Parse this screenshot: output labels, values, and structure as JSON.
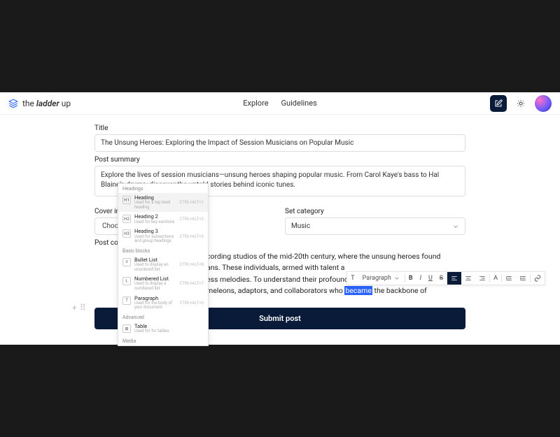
{
  "brand": {
    "pre": "the",
    "em": "ladder",
    "post": "up"
  },
  "nav": {
    "explore": "Explore",
    "guidelines": "Guidelines"
  },
  "labels": {
    "title": "Title",
    "summary": "Post summary",
    "cover": "Cover im",
    "category": "Set category",
    "content": "Post con"
  },
  "fields": {
    "title": "The Unsung Heroes: Exploring the Impact of Session Musicians on Popular Music",
    "summary": "Explore the lives of session musicians—unsung heroes shaping popular music. From Carol Kaye's bass to Hal Blaine's drums, discover the untold stories behind iconic tunes.",
    "choose": "Choo",
    "category": "Music"
  },
  "doc": {
    "l1a": "cording studios of the mid-20th century, where the unsung heroes found",
    "l2a": "ans. These individuals, armed with talent a",
    "l3a": "ess melodies. To understand their profound impact, one must delve into",
    "l4a": "meleons, adaptors, and collaborators who ",
    "l4h": "became",
    "l4b": " the backbone of"
  },
  "toolbar": {
    "t": "T",
    "para": "Paragraph",
    "b": "B",
    "i": "I",
    "u": "U",
    "s": "S",
    "a": "A"
  },
  "menu": {
    "g1": "Headings",
    "h1": {
      "t": "Heading",
      "d": "Used for a top level heading",
      "ic": "H1",
      "sc": "CTRL+ALT+1"
    },
    "h2": {
      "t": "Heading 2",
      "d": "Used for key sections",
      "ic": "H2",
      "sc": "CTRL+ALT+2"
    },
    "h3": {
      "t": "Heading 3",
      "d": "Used for subsections and group headings",
      "ic": "H3",
      "sc": "CTRL+ALT+3"
    },
    "g2": "Basic blocks",
    "bl": {
      "t": "Bullet List",
      "d": "Used to display an unordered list",
      "ic": "≡",
      "sc": "CTRL+ALT+8"
    },
    "nl": {
      "t": "Numbered List",
      "d": "Used to display a numbered list",
      "ic": "1.",
      "sc": "CTRL+ALT+7"
    },
    "p": {
      "t": "Paragraph",
      "d": "Used for the body of your document",
      "ic": "T",
      "sc": "CTRL+ALT+0"
    },
    "g3": "Advanced",
    "tb": {
      "t": "Table",
      "d": "Used for for tables",
      "ic": "⊞"
    },
    "g4": "Media"
  },
  "submit": "Submit post"
}
